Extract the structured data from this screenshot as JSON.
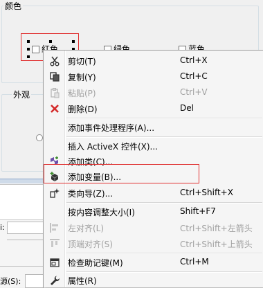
{
  "dialog": {
    "color_group_title": "颜色",
    "appearance_group_title": "外观",
    "checkboxes": [
      {
        "label": "红色"
      },
      {
        "label": "绿色"
      },
      {
        "label": "蓝色"
      }
    ],
    "lower_label_1": "i:",
    "lower_label_2": "源(S):"
  },
  "context_menu": {
    "items": [
      {
        "label": "剪切(T)",
        "shortcut": "Ctrl+X",
        "icon": "scissors-icon",
        "disabled": false
      },
      {
        "label": "复制(Y)",
        "shortcut": "Ctrl+C",
        "icon": "copy-icon",
        "disabled": false
      },
      {
        "label": "粘贴(P)",
        "shortcut": "Ctrl+V",
        "icon": "paste-icon",
        "disabled": true
      },
      {
        "label": "删除(D)",
        "shortcut": "Del",
        "icon": "delete-icon",
        "disabled": false
      },
      {
        "label": "添加事件处理程序(A)...",
        "shortcut": "",
        "icon": "",
        "disabled": false
      },
      {
        "label": "插入 ActiveX 控件(X)...",
        "shortcut": "",
        "icon": "",
        "disabled": false
      },
      {
        "label": "添加类(C)...",
        "shortcut": "",
        "icon": "add-class-icon",
        "disabled": false
      },
      {
        "label": "添加变量(B)...",
        "shortcut": "",
        "icon": "add-variable-icon",
        "disabled": false
      },
      {
        "label": "类向导(Z)...",
        "shortcut": "Ctrl+Shift+X",
        "icon": "class-wizard-icon",
        "disabled": false
      },
      {
        "label": "按内容调整大小(I)",
        "shortcut": "Shift+F7",
        "icon": "",
        "disabled": false
      },
      {
        "label": "左对齐(L)",
        "shortcut": "Ctrl+Shift+左箭头",
        "icon": "align-left-icon",
        "disabled": true
      },
      {
        "label": "顶端对齐(S)",
        "shortcut": "Ctrl+Shift+上箭头",
        "icon": "align-top-icon",
        "disabled": true
      },
      {
        "label": "检查助记键(M)",
        "shortcut": "Ctrl+M",
        "icon": "check-mnemonics-icon",
        "disabled": false
      },
      {
        "label": "属性(R)",
        "shortcut": "",
        "icon": "wrench-icon",
        "disabled": false
      }
    ],
    "highlighted_item": "添加变量(B)...",
    "colors": {
      "delete_icon": "#d42a2a",
      "annotation_box": "#e03030"
    }
  }
}
